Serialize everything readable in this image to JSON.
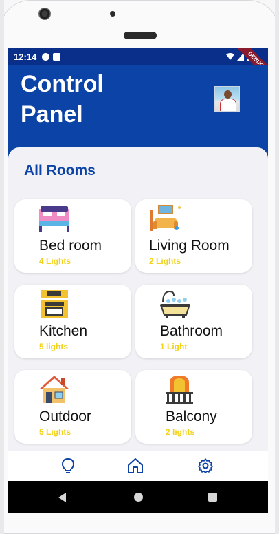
{
  "status_bar": {
    "time": "12:14",
    "debug_label": "DEBUG"
  },
  "header": {
    "title": "Control Panel",
    "background_color": "#0b43a6"
  },
  "section": {
    "title": "All Rooms"
  },
  "rooms": [
    {
      "name": "Bed room",
      "lights": "4 Lights",
      "icon": "bed-icon"
    },
    {
      "name": "Living Room",
      "lights": "2 Lights",
      "icon": "sofa-icon"
    },
    {
      "name": "Kitchen",
      "lights": "5 lights",
      "icon": "kitchen-icon"
    },
    {
      "name": "Bathroom",
      "lights": "1 Light",
      "icon": "bathtub-icon"
    },
    {
      "name": "Outdoor",
      "lights": "5 Lights",
      "icon": "house-icon"
    },
    {
      "name": "Balcony",
      "lights": "2 lights",
      "icon": "balcony-icon"
    }
  ],
  "bottom_nav": {
    "items": [
      "lightbulb-icon",
      "home-icon",
      "gear-icon"
    ],
    "active_color": "#0b43a6"
  },
  "colors": {
    "accent": "#0b43a6",
    "light_count": "#f2d21a",
    "card": "#ffffff"
  }
}
